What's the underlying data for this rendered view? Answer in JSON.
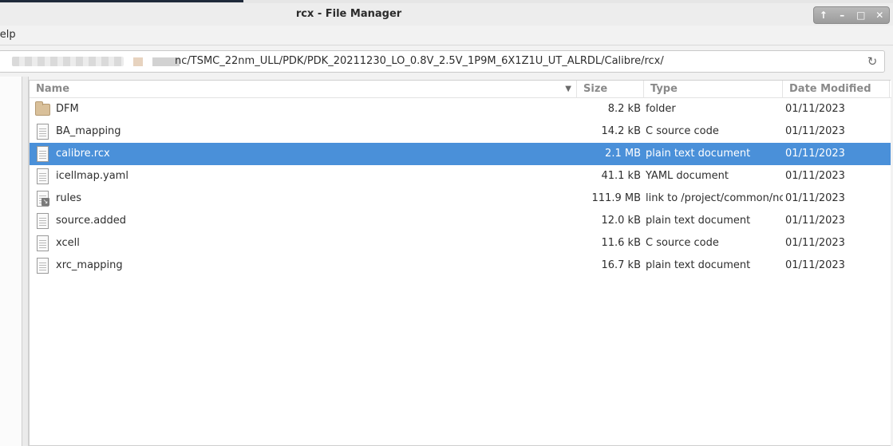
{
  "window": {
    "title": "rcx - File Manager",
    "controls": {
      "up": "↑",
      "minimize": "–",
      "maximize": "□",
      "close": "✕"
    }
  },
  "menubar": {
    "help": "Help"
  },
  "location": {
    "path": "/project/common/nc/TSMC_22nm_ULL/PDK/PDK_20211230_LO_0.8V_2.5V_1P9M_6X1Z1U_UT_ALRDL/Calibre/rcx/",
    "visible_path": "nc/TSMC_22nm_ULL/PDK/PDK_20211230_LO_0.8V_2.5V_1P9M_6X1Z1U_UT_ALRDL/Calibre/rcx/",
    "reload_icon": "↻"
  },
  "columns": {
    "name": "Name",
    "size": "Size",
    "type": "Type",
    "date": "Date Modified",
    "sort_arrow": "▼"
  },
  "files": [
    {
      "name": "DFM",
      "size": "8.2 kB",
      "type": "folder",
      "date": "01/11/2023",
      "icon": "folder-icon"
    },
    {
      "name": "BA_mapping",
      "size": "14.2 kB",
      "type": "C source code",
      "date": "01/11/2023",
      "icon": "text-file-icon"
    },
    {
      "name": "calibre.rcx",
      "size": "2.1 MB",
      "type": "plain text document",
      "date": "01/11/2023",
      "icon": "text-file-icon",
      "selected": true
    },
    {
      "name": "icellmap.yaml",
      "size": "41.1 kB",
      "type": "YAML document",
      "date": "01/11/2023",
      "icon": "text-file-icon"
    },
    {
      "name": "rules",
      "size": "111.9 MB",
      "type": "link to /project/common/nc",
      "date": "01/11/2023",
      "icon": "link-file-icon"
    },
    {
      "name": "source.added",
      "size": "12.0 kB",
      "type": "plain text document",
      "date": "01/11/2023",
      "icon": "text-file-icon"
    },
    {
      "name": "xcell",
      "size": "11.6 kB",
      "type": "C source code",
      "date": "01/11/2023",
      "icon": "text-file-icon"
    },
    {
      "name": "xrc_mapping",
      "size": "16.7 kB",
      "type": "plain text document",
      "date": "01/11/2023",
      "icon": "text-file-icon"
    }
  ],
  "colors": {
    "selection": "#4a90d9"
  }
}
